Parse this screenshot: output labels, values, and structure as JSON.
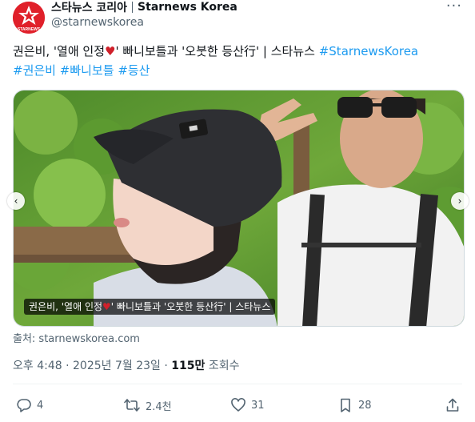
{
  "account": {
    "display_name": "스타뉴스 코리아",
    "org_name": "Starnews Korea",
    "handle": "@starnewskorea",
    "avatar_text": "STARNEWS"
  },
  "tweet": {
    "text_prefix": "권은비, '열애 인정",
    "heart": "♥",
    "text_middle": "' 빠니보틀과 '오붓한 등산行' | 스타뉴스 ",
    "hashtags": [
      "#StarnewsKorea",
      "#권은비",
      "#빠니보틀",
      "#등산"
    ]
  },
  "media": {
    "caption_prefix": "권은비, '열애 인정",
    "caption_suffix": "' 빠니보틀과 '오붓한 등산行' | 스타뉴스",
    "source": "출처: starnewskorea.com"
  },
  "meta": {
    "time": "오후 4:48",
    "date": "2025년 7월 23일",
    "views_count": "115만",
    "views_label": "조회수"
  },
  "actions": {
    "replies": "4",
    "reposts": "2.4천",
    "likes": "31",
    "bookmarks": "28"
  },
  "colors": {
    "accent": "#1d9bf0",
    "brand": "#e0202a",
    "text": "#0f1419",
    "muted": "#536471"
  },
  "icons": [
    "more-icon",
    "reply-icon",
    "repost-icon",
    "like-icon",
    "bookmark-icon",
    "share-icon",
    "prev-arrow-icon",
    "next-arrow-icon"
  ]
}
